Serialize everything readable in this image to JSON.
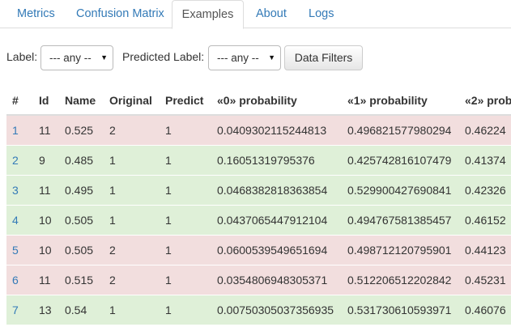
{
  "tabs": [
    {
      "label": "Metrics"
    },
    {
      "label": "Confusion Matrix"
    },
    {
      "label": "Examples"
    },
    {
      "label": "About"
    },
    {
      "label": "Logs"
    }
  ],
  "active_tab": "Examples",
  "filters": {
    "label_text": "Label:",
    "label_value": "--- any --",
    "predicted_label_text": "Predicted Label:",
    "predicted_label_value": "--- any --",
    "data_filters_button": "Data Filters"
  },
  "table": {
    "headers": [
      "#",
      "Id",
      "Name",
      "Original",
      "Predict",
      "«0» probability",
      "«1» probability",
      "«2» prob"
    ],
    "rows": [
      {
        "status": "mismatch",
        "cells": [
          "1",
          "11",
          "0.525",
          "2",
          "1",
          "0.0409302115244813",
          "0.496821577980294",
          "0.46224"
        ]
      },
      {
        "status": "match",
        "cells": [
          "2",
          "9",
          "0.485",
          "1",
          "1",
          "0.16051319795376",
          "0.425742816107479",
          "0.41374"
        ]
      },
      {
        "status": "match",
        "cells": [
          "3",
          "11",
          "0.495",
          "1",
          "1",
          "0.0468382818363854",
          "0.529900427690841",
          "0.42326"
        ]
      },
      {
        "status": "match",
        "cells": [
          "4",
          "10",
          "0.505",
          "1",
          "1",
          "0.0437065447912104",
          "0.494767581385457",
          "0.46152"
        ]
      },
      {
        "status": "mismatch",
        "cells": [
          "5",
          "10",
          "0.505",
          "2",
          "1",
          "0.0600539549651694",
          "0.498712120795901",
          "0.44123"
        ]
      },
      {
        "status": "mismatch",
        "cells": [
          "6",
          "11",
          "0.515",
          "2",
          "1",
          "0.0354806948305371",
          "0.512206512202842",
          "0.45231"
        ]
      },
      {
        "status": "match",
        "cells": [
          "7",
          "13",
          "0.54",
          "1",
          "1",
          "0.00750305037356935",
          "0.531730610593971",
          "0.46076"
        ]
      }
    ]
  },
  "colors": {
    "link": "#337ab7",
    "mismatch_row": "#f2dede",
    "match_row": "#dff0d8"
  },
  "icons": {
    "select_caret": "▼"
  }
}
